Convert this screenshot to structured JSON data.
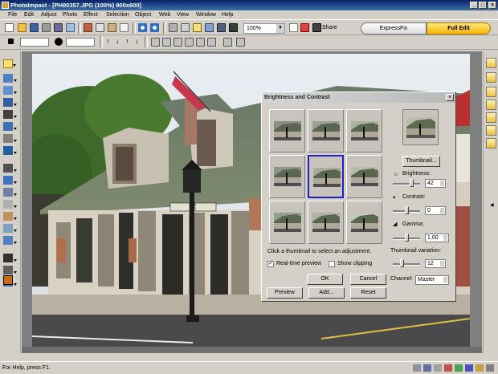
{
  "window": {
    "title": "PhotoImpact - [PH00357.JPG (100%) 900x600]",
    "minimize_glyph": "_",
    "maximize_glyph": "□",
    "close_glyph": "×"
  },
  "menu": [
    "File",
    "Edit",
    "Adjust",
    "Photo",
    "Effect",
    "Selection",
    "Object",
    "Web",
    "View",
    "Window",
    "Help"
  ],
  "toolbar": {
    "zoom_value": "100%",
    "share_label": "Share",
    "expressfix_label": "ExpressFix",
    "fulledit_label": "Full Edit"
  },
  "dialog": {
    "title": "Brightness and Contrast",
    "close_glyph": "×",
    "thumbnail_button": "Thumbnail...",
    "brightness_label": "Brightness:",
    "brightness_value": "42",
    "contrast_label": "Contrast:",
    "contrast_value": "0",
    "gamma_label": "Gamma:",
    "gamma_value": "1.00",
    "hint": "Click a thumbnail to select an adjustment.",
    "realtime_label": "Real-time preview",
    "realtime_checked": "✓",
    "clipping_label": "Show clipping",
    "variation_label": "Thumbnail variation:",
    "variation_value": "12",
    "channel_label": "Channel:",
    "channel_value": "Master",
    "ok": "OK",
    "cancel": "Cancel",
    "preview": "Preview",
    "add": "Add...",
    "reset": "Reset"
  },
  "status": {
    "text": "For Help, press F1."
  },
  "colors": {
    "titlebar": "#0a246a",
    "fulledit": "#f5b400",
    "foreground_swatch": "#c86a10",
    "selected_thumb_border": "#2020c0"
  }
}
